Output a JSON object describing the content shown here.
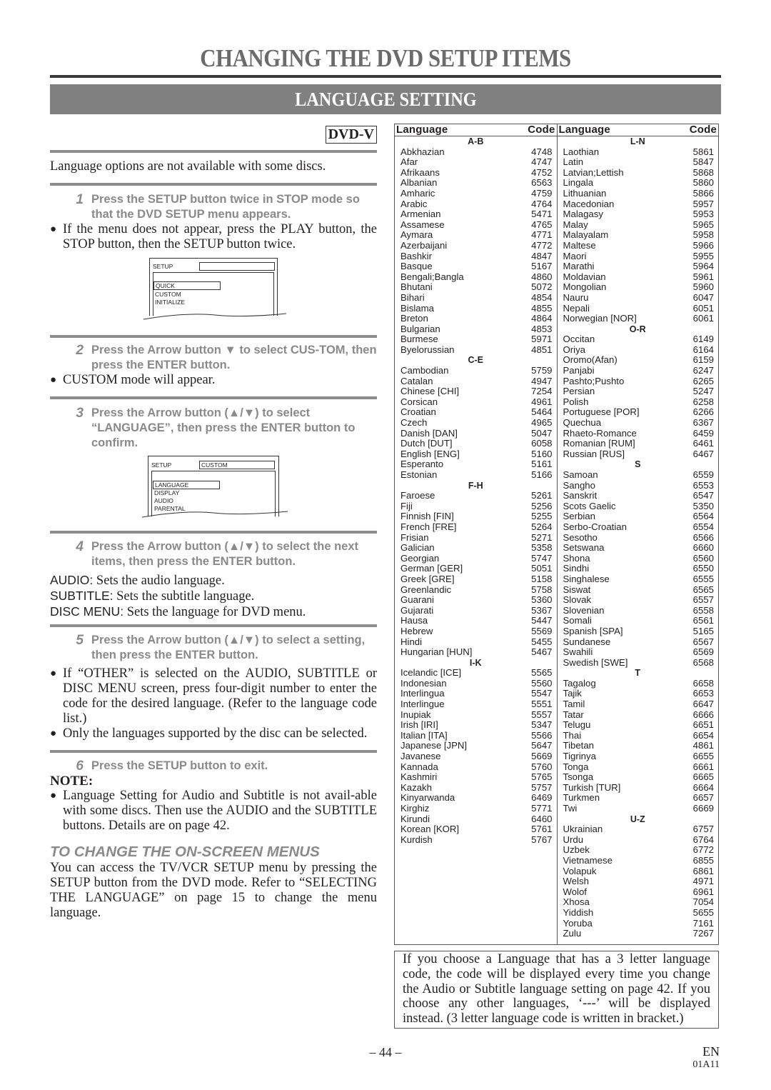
{
  "page": {
    "title": "CHANGING THE DVD SETUP ITEMS",
    "section": "LANGUAGE SETTING",
    "badge": "DVD-V",
    "intro": "Language options are not available with some discs.",
    "steps": [
      {
        "num": "1",
        "text": "Press the SETUP button twice in STOP mode so that the DVD SETUP menu appears."
      },
      {
        "num": "2",
        "text": "Press the Arrow button ▼ to select CUS-TOM, then press the ENTER button."
      },
      {
        "num": "3",
        "text": "Press the Arrow button (▲/▼) to select “LANGUAGE”, then press the ENTER button to confirm."
      },
      {
        "num": "4",
        "text": "Press the Arrow button (▲/▼) to select the next items, then press the ENTER button."
      },
      {
        "num": "5",
        "text": "Press the Arrow button (▲/▼) to select a setting, then press the ENTER button."
      },
      {
        "num": "6",
        "text": "Press the SETUP button to exit."
      }
    ],
    "step1_bullet": "If the menu does not appear, press the PLAY button, the STOP button, then the SETUP button twice.",
    "step2_bullet": "CUSTOM mode will appear.",
    "screen1": {
      "header": "SETUP",
      "field": "",
      "items": [
        "QUICK",
        "CUSTOM",
        "INITIALIZE"
      ]
    },
    "screen2": {
      "header": "SETUP",
      "field": "CUSTOM",
      "items": [
        "LANGUAGE",
        "DISPLAY",
        "AUDIO",
        "PARENTAL"
      ]
    },
    "definitions": [
      {
        "term": "AUDIO:",
        "desc": " Sets the audio language."
      },
      {
        "term": "SUBTITLE:",
        "desc": " Sets the subtitle language."
      },
      {
        "term": "DISC MENU:",
        "desc": " Sets the language for DVD menu."
      }
    ],
    "step5_bullets": [
      "If “OTHER” is selected on the AUDIO, SUBTITLE or DISC MENU screen, press four-digit number to enter the code for the desired language. (Refer to the language code list.)",
      "Only the languages supported by the disc can be selected."
    ],
    "note_heading": "NOTE:",
    "note_bullet": "Language Setting for Audio and Subtitle is not avail-able with some discs. Then use the AUDIO and the SUBTITLE buttons. Details are on page 42.",
    "subheading": "TO CHANGE THE ON-SCREEN MENUS",
    "subtext": "You can access the TV/VCR SETUP menu by pressing the SETUP button from the DVD mode. Refer to “SELECTING THE LANGUAGE” on page 15 to change the menu language.",
    "info_box": "If you choose a Language that has a 3 letter language code, the code will be displayed every time you change the Audio or Subtitle language setting on page 42. If you choose any other languages, ‘---’ will be displayed instead. (3 letter language code is written in bracket.)",
    "page_number": "– 44 –",
    "lang_code": "EN",
    "doc_code": "01A11"
  },
  "table": {
    "header_language": "Language",
    "header_code": "Code",
    "columns": [
      [
        {
          "group": "A-B"
        },
        [
          "Abkhazian",
          "4748"
        ],
        [
          "Afar",
          "4747"
        ],
        [
          "Afrikaans",
          "4752"
        ],
        [
          "Albanian",
          "6563"
        ],
        [
          "Amharic",
          "4759"
        ],
        [
          "Arabic",
          "4764"
        ],
        [
          "Armenian",
          "5471"
        ],
        [
          "Assamese",
          "4765"
        ],
        [
          "Aymara",
          "4771"
        ],
        [
          "Azerbaijani",
          "4772"
        ],
        [
          "Bashkir",
          "4847"
        ],
        [
          "Basque",
          "5167"
        ],
        [
          "Bengali;Bangla",
          "4860"
        ],
        [
          "Bhutani",
          "5072"
        ],
        [
          "Bihari",
          "4854"
        ],
        [
          "Bislama",
          "4855"
        ],
        [
          "Breton",
          "4864"
        ],
        [
          "Bulgarian",
          "4853"
        ],
        [
          "Burmese",
          "5971"
        ],
        [
          "Byelorussian",
          "4851"
        ],
        {
          "group": "C-E"
        },
        [
          "Cambodian",
          "5759"
        ],
        [
          "Catalan",
          "4947"
        ],
        [
          "Chinese [CHI]",
          "7254"
        ],
        [
          "Corsican",
          "4961"
        ],
        [
          "Croatian",
          "5464"
        ],
        [
          "Czech",
          "4965"
        ],
        [
          "Danish [DAN]",
          "5047"
        ],
        [
          "Dutch [DUT]",
          "6058"
        ],
        [
          "English [ENG]",
          "5160"
        ],
        [
          "Esperanto",
          "5161"
        ],
        [
          "Estonian",
          "5166"
        ],
        {
          "group": "F-H"
        },
        [
          "Faroese",
          "5261"
        ],
        [
          "Fiji",
          "5256"
        ],
        [
          "Finnish [FIN]",
          "5255"
        ],
        [
          "French [FRE]",
          "5264"
        ],
        [
          "Frisian",
          "5271"
        ],
        [
          "Galician",
          "5358"
        ],
        [
          "Georgian",
          "5747"
        ],
        [
          "German [GER]",
          "5051"
        ],
        [
          "Greek [GRE]",
          "5158"
        ],
        [
          "Greenlandic",
          "5758"
        ],
        [
          "Guarani",
          "5360"
        ],
        [
          "Gujarati",
          "5367"
        ],
        [
          "Hausa",
          "5447"
        ],
        [
          "Hebrew",
          "5569"
        ],
        [
          "Hindi",
          "5455"
        ],
        [
          "Hungarian [HUN]",
          "5467"
        ],
        {
          "group": "I-K"
        },
        [
          "Icelandic [ICE]",
          "5565"
        ],
        [
          "Indonesian",
          "5560"
        ],
        [
          "Interlingua",
          "5547"
        ],
        [
          "Interlingue",
          "5551"
        ],
        [
          "Inupiak",
          "5557"
        ],
        [
          "Irish [IRI]",
          "5347"
        ],
        [
          "Italian [ITA]",
          "5566"
        ],
        [
          "Japanese [JPN]",
          "5647"
        ],
        [
          "Javanese",
          "5669"
        ],
        [
          "Kannada",
          "5760"
        ],
        [
          "Kashmiri",
          "5765"
        ],
        [
          "Kazakh",
          "5757"
        ],
        [
          "Kinyarwanda",
          "6469"
        ],
        [
          "Kirghiz",
          "5771"
        ],
        [
          "Kirundi",
          "6460"
        ],
        [
          "Korean [KOR]",
          "5761"
        ],
        [
          "Kurdish",
          "5767"
        ]
      ],
      [
        {
          "group": "L-N"
        },
        [
          "Laothian",
          "5861"
        ],
        [
          "Latin",
          "5847"
        ],
        [
          "Latvian;Lettish",
          "5868"
        ],
        [
          "Lingala",
          "5860"
        ],
        [
          "Lithuanian",
          "5866"
        ],
        [
          "Macedonian",
          "5957"
        ],
        [
          "Malagasy",
          "5953"
        ],
        [
          "Malay",
          "5965"
        ],
        [
          "Malayalam",
          "5958"
        ],
        [
          "Maltese",
          "5966"
        ],
        [
          "Maori",
          "5955"
        ],
        [
          "Marathi",
          "5964"
        ],
        [
          "Moldavian",
          "5961"
        ],
        [
          "Mongolian",
          "5960"
        ],
        [
          "Nauru",
          "6047"
        ],
        [
          "Nepali",
          "6051"
        ],
        [
          "Norwegian [NOR]",
          "6061"
        ],
        {
          "group": "O-R"
        },
        [
          "Occitan",
          "6149"
        ],
        [
          "Oriya",
          "6164"
        ],
        [
          "Oromo(Afan)",
          "6159"
        ],
        [
          "Panjabi",
          "6247"
        ],
        [
          "Pashto;Pushto",
          "6265"
        ],
        [
          "Persian",
          "5247"
        ],
        [
          "Polish",
          "6258"
        ],
        [
          "Portuguese [POR]",
          "6266"
        ],
        [
          "Quechua",
          "6367"
        ],
        [
          "Rhaeto-Romance",
          "6459"
        ],
        [
          "Romanian [RUM]",
          "6461"
        ],
        [
          "Russian [RUS]",
          "6467"
        ],
        {
          "group": "S"
        },
        [
          "Samoan",
          "6559"
        ],
        [
          "Sangho",
          "6553"
        ],
        [
          "Sanskrit",
          "6547"
        ],
        [
          "Scots Gaelic",
          "5350"
        ],
        [
          "Serbian",
          "6564"
        ],
        [
          "Serbo-Croatian",
          "6554"
        ],
        [
          "Sesotho",
          "6566"
        ],
        [
          "Setswana",
          "6660"
        ],
        [
          "Shona",
          "6560"
        ],
        [
          "Sindhi",
          "6550"
        ],
        [
          "Singhalese",
          "6555"
        ],
        [
          "Siswat",
          "6565"
        ],
        [
          "Slovak",
          "6557"
        ],
        [
          "Slovenian",
          "6558"
        ],
        [
          "Somali",
          "6561"
        ],
        [
          "Spanish [SPA]",
          "5165"
        ],
        [
          "Sundanese",
          "6567"
        ],
        [
          "Swahili",
          "6569"
        ],
        [
          "Swedish [SWE]",
          "6568"
        ],
        {
          "group": "T"
        },
        [
          "Tagalog",
          "6658"
        ],
        [
          "Tajik",
          "6653"
        ],
        [
          "Tamil",
          "6647"
        ],
        [
          "Tatar",
          "6666"
        ],
        [
          "Telugu",
          "6651"
        ],
        [
          "Thai",
          "6654"
        ],
        [
          "Tibetan",
          "4861"
        ],
        [
          "Tigrinya",
          "6655"
        ],
        [
          "Tonga",
          "6661"
        ],
        [
          "Tsonga",
          "6665"
        ],
        [
          "Turkish [TUR]",
          "6664"
        ],
        [
          "Turkmen",
          "6657"
        ],
        [
          "Twi",
          "6669"
        ],
        {
          "group": "U-Z"
        },
        [
          "Ukrainian",
          "6757"
        ],
        [
          "Urdu",
          "6764"
        ],
        [
          "Uzbek",
          "6772"
        ],
        [
          "Vietnamese",
          "6855"
        ],
        [
          "Volapuk",
          "6861"
        ],
        [
          "Welsh",
          "4971"
        ],
        [
          "Wolof",
          "6961"
        ],
        [
          "Xhosa",
          "7054"
        ],
        [
          "Yiddish",
          "5655"
        ],
        [
          "Yoruba",
          "7161"
        ],
        [
          "Zulu",
          "7267"
        ]
      ]
    ]
  }
}
